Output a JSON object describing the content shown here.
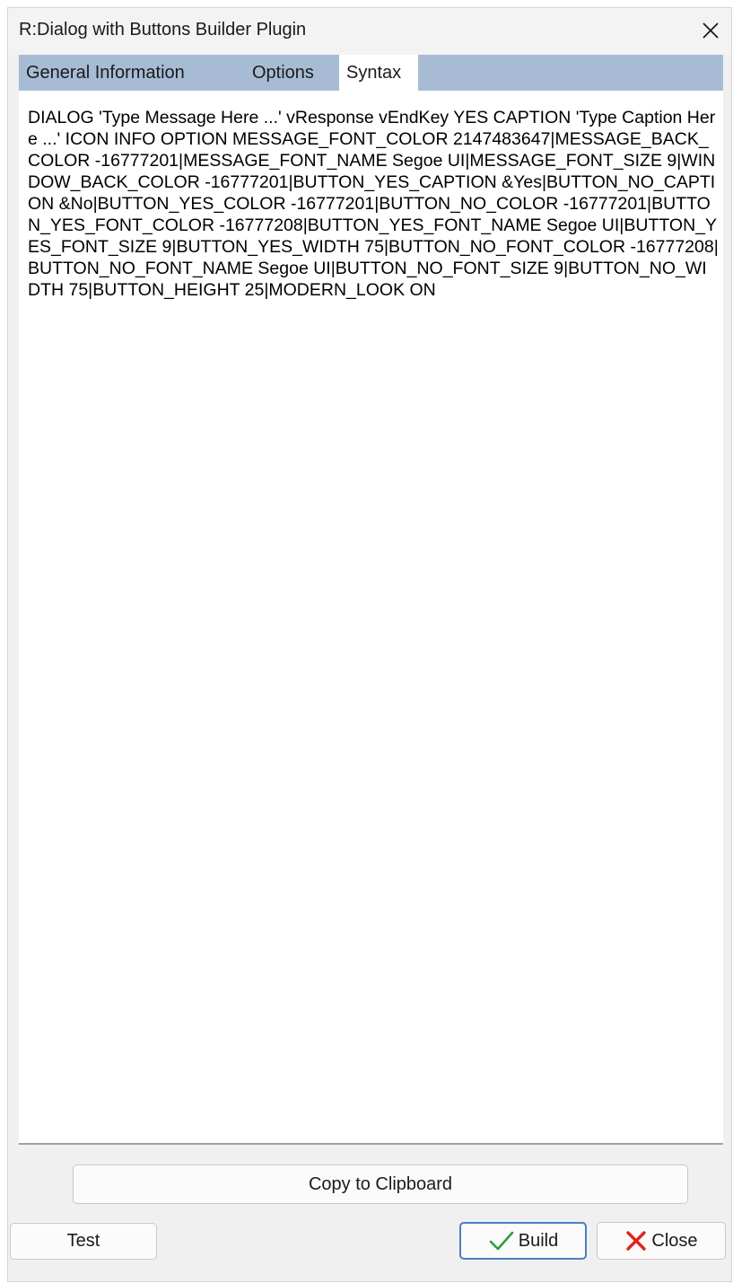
{
  "window": {
    "title": "R:Dialog with Buttons Builder Plugin"
  },
  "tabs": [
    {
      "label": "General Information",
      "active": false
    },
    {
      "label": "Options",
      "active": false
    },
    {
      "label": "Syntax",
      "active": true
    }
  ],
  "syntax": {
    "text": "DIALOG 'Type Message Here ...' vResponse vEndKey  YES  CAPTION 'Type Caption Here ...' ICON INFO OPTION MESSAGE_FONT_COLOR 2147483647|MESSAGE_BACK_COLOR -16777201|MESSAGE_FONT_NAME Segoe UI|MESSAGE_FONT_SIZE 9|WINDOW_BACK_COLOR -16777201|BUTTON_YES_CAPTION &Yes|BUTTON_NO_CAPTION &No|BUTTON_YES_COLOR -16777201|BUTTON_NO_COLOR -16777201|BUTTON_YES_FONT_COLOR -16777208|BUTTON_YES_FONT_NAME Segoe UI|BUTTON_YES_FONT_SIZE 9|BUTTON_YES_WIDTH 75|BUTTON_NO_FONT_COLOR -16777208|BUTTON_NO_FONT_NAME Segoe UI|BUTTON_NO_FONT_SIZE 9|BUTTON_NO_WIDTH 75|BUTTON_HEIGHT 25|MODERN_LOOK ON"
  },
  "buttons": {
    "copy_label": "Copy to Clipboard",
    "test_label": "Test",
    "build_label": "Build",
    "close_label": "Close"
  },
  "icons": {
    "window_close": "close-icon",
    "build": "checkmark-icon",
    "close": "red-x-icon"
  },
  "colors": {
    "tab_bar": "#a7bcd4",
    "build_icon": "#2e9e3a",
    "close_icon": "#e0231b",
    "primary_border": "#4a7fc0"
  }
}
